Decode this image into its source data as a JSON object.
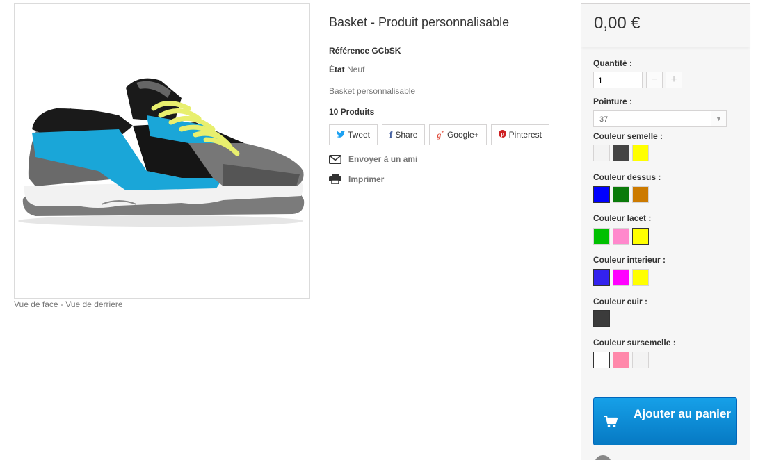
{
  "product": {
    "title": "Basket - Produit personnalisable",
    "reference_label": "Référence",
    "reference_value": "GCbSK",
    "state_label": "État",
    "state_value": "Neuf",
    "description": "Basket personnalisable",
    "quantity_in_stock": "10 Produits",
    "image_caption": "Vue de face - Vue de derriere"
  },
  "share": {
    "tweet": "Tweet",
    "share": "Share",
    "googleplus": "Google+",
    "pinterest": "Pinterest"
  },
  "links": {
    "send_friend": "Envoyer à un ami",
    "print": "Imprimer"
  },
  "box": {
    "price": "0,00 €",
    "quantity_label": "Quantité :",
    "quantity_value": "1",
    "minus": "−",
    "plus": "+",
    "size_label": "Pointure :",
    "size_value": "37",
    "sole_label": "Couleur semelle :",
    "top_label": "Couleur dessus :",
    "lace_label": "Couleur lacet :",
    "inner_label": "Couleur interieur :",
    "leather_label": "Couleur cuir :",
    "oversole_label": "Couleur sursemelle :",
    "add_to_cart": "Ajouter au panier"
  },
  "colors": {
    "sole": [
      "#f3f3f3",
      "#444444",
      "#ffff00"
    ],
    "top": [
      "#0000ff",
      "#0a7a0a",
      "#cc7a00"
    ],
    "lace": [
      "#00c000",
      "#ff88cc",
      "#ffff00"
    ],
    "inner": [
      "#3322ee",
      "#ff00ff",
      "#ffff00"
    ],
    "leather": [
      "#3b3b3b"
    ],
    "oversole": [
      "#ffffff",
      "#ff88aa",
      "#f3f3f3"
    ]
  },
  "icons": {
    "twitter": "twitter-icon",
    "facebook": "facebook-icon",
    "googleplus": "google-plus-icon",
    "pinterest": "pinterest-icon",
    "envelope": "envelope-icon",
    "printer": "printer-icon",
    "cart": "cart-icon"
  }
}
